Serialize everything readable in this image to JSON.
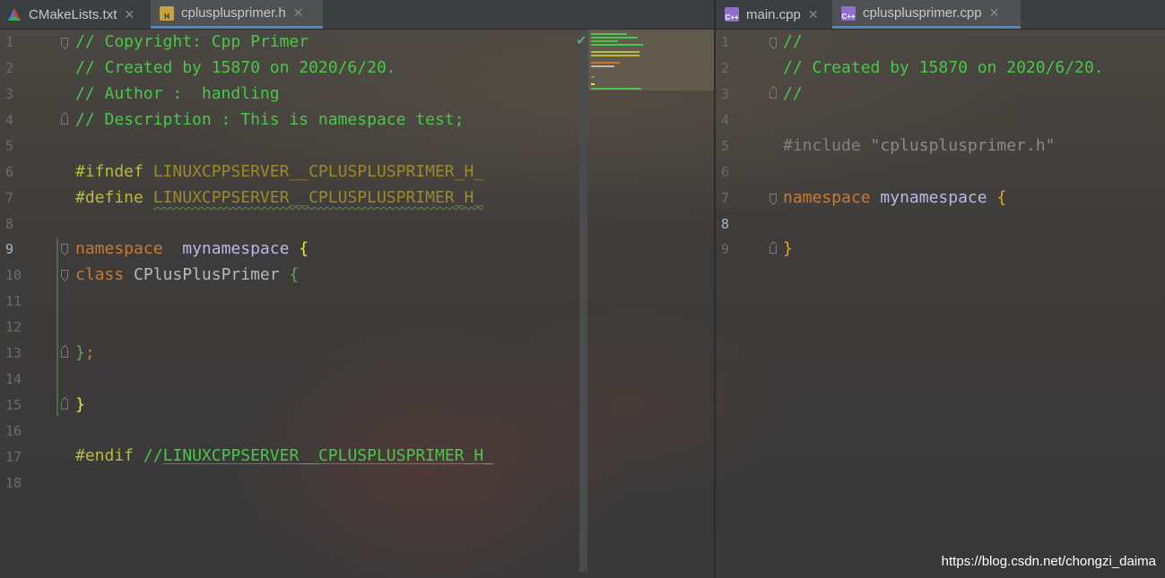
{
  "left_tabs": [
    {
      "label": "CMakeLists.txt",
      "icon": "cmake-icon",
      "active": false
    },
    {
      "label": "cplusplusprimer.h",
      "icon": "header-file-icon",
      "active": true
    }
  ],
  "right_tabs": [
    {
      "label": "main.cpp",
      "icon": "cpp-file-icon",
      "active": false
    },
    {
      "label": "cplusplusprimer.cpp",
      "icon": "cpp-file-icon",
      "active": true
    }
  ],
  "left_editor": {
    "current_line": 9,
    "line_numbers": [
      "1",
      "2",
      "3",
      "4",
      "5",
      "6",
      "7",
      "8",
      "9",
      "10",
      "11",
      "12",
      "13",
      "14",
      "15",
      "16",
      "17",
      "18"
    ],
    "lines": {
      "l1": "// Copyright: Cpp Primer",
      "l2": "// Created by 15870 on 2020/6/20.",
      "l3": "// Author :  handling",
      "l4": "// Description : This is namespace test;",
      "l6_dir": "#ifndef",
      "l6_macro": "LINUXCPPSERVER__CPLUSPLUSPRIMER_H_",
      "l7_dir": "#define",
      "l7_macro": "LINUXCPPSERVER__CPLUSPLUSPRIMER_H_",
      "l9_kw": "namespace",
      "l9_name": "mynamespace",
      "l9_brace": "{",
      "l10_kw": "class",
      "l10_name": "CPlusPlusPrimer",
      "l10_brace": "{",
      "l13_close": "}",
      "l13_semi": ";",
      "l15_close": "}",
      "l17_dir": "#endif",
      "l17_cmt_prefix": "//",
      "l17_cmt_macro": "LINUXCPPSERVER__CPLUSPLUSPRIMER_H_"
    }
  },
  "right_editor": {
    "current_line": 8,
    "line_numbers": [
      "1",
      "2",
      "3",
      "4",
      "5",
      "6",
      "7",
      "8",
      "9"
    ],
    "lines": {
      "l1": "//",
      "l2": "// Created by 15870 on 2020/6/20.",
      "l3": "//",
      "l5_dir": "#include",
      "l5_str": "\"cplusplusprimer.h\"",
      "l7_kw": "namespace",
      "l7_name": "mynamespace",
      "l7_brace": "{",
      "l9_close": "}"
    }
  },
  "inspection_status": "check-icon",
  "watermark": "https://blog.csdn.net/chongzi_daima",
  "colors": {
    "comment": "#48c748",
    "keyword": "#cc7832",
    "directive": "#b9b93e",
    "namespace_name": "#b8b8e8",
    "accent_tab": "#4a88c7"
  }
}
